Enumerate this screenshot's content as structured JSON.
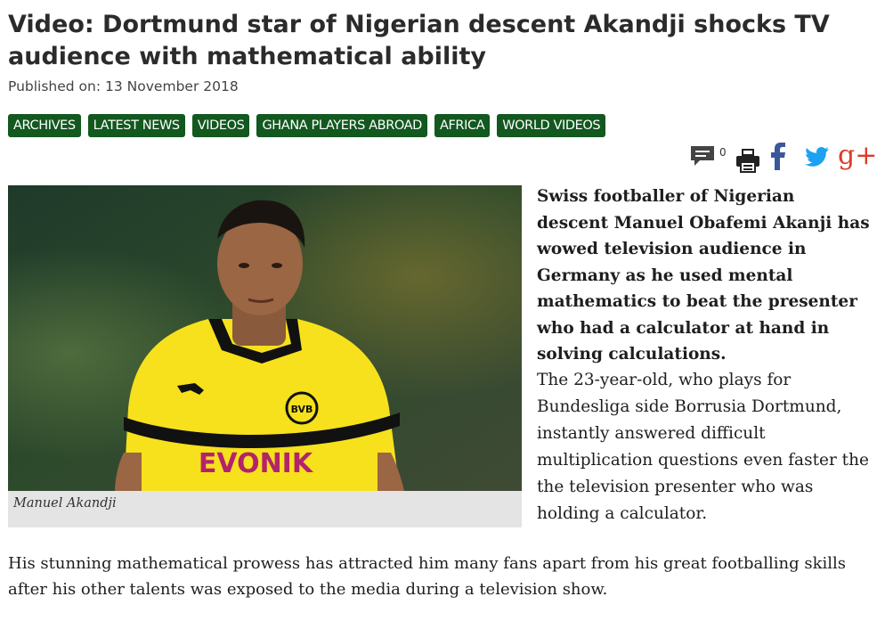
{
  "article": {
    "title": "Video: Dortmund star of Nigerian descent Akandji shocks TV audience with mathematical ability",
    "published_label": "Published on:",
    "published_date": "13 November 2018"
  },
  "tags": [
    "ARCHIVES",
    "LATEST NEWS",
    "VIDEOS",
    "GHANA PLAYERS ABROAD",
    "AFRICA",
    "WORLD VIDEOS"
  ],
  "share": {
    "comment_count": "0",
    "icons": [
      "comment-icon",
      "print-icon",
      "facebook-icon",
      "twitter-icon",
      "google-plus-icon"
    ],
    "google_plus_glyph": "g+"
  },
  "image": {
    "caption": "Manuel Akandji",
    "shirt_sponsor": "EVONIK",
    "crest": "BVB 09"
  },
  "body": {
    "lede": "Swiss footballer of Nigerian descent Manuel Obafemi Akanji has wowed television audience in Germany as he used mental mathematics to beat the presenter who had a calculator at hand in solving calculations.",
    "paragraph2": "The 23-year-old, who plays for Bundesliga side Borrusia Dortmund, instantly answered difficult multiplication questions even faster the the television presenter who was holding a calculator.",
    "paragraph3": "His stunning mathematical prowess has attracted him many fans apart from his great footballing skills after his other talents was exposed to the media during a television show."
  },
  "colors": {
    "tag_bg": "#12581f",
    "facebook": "#3b5998",
    "twitter": "#1da1f2",
    "google_plus": "#dd3b2a",
    "jersey": "#f6e11c"
  }
}
